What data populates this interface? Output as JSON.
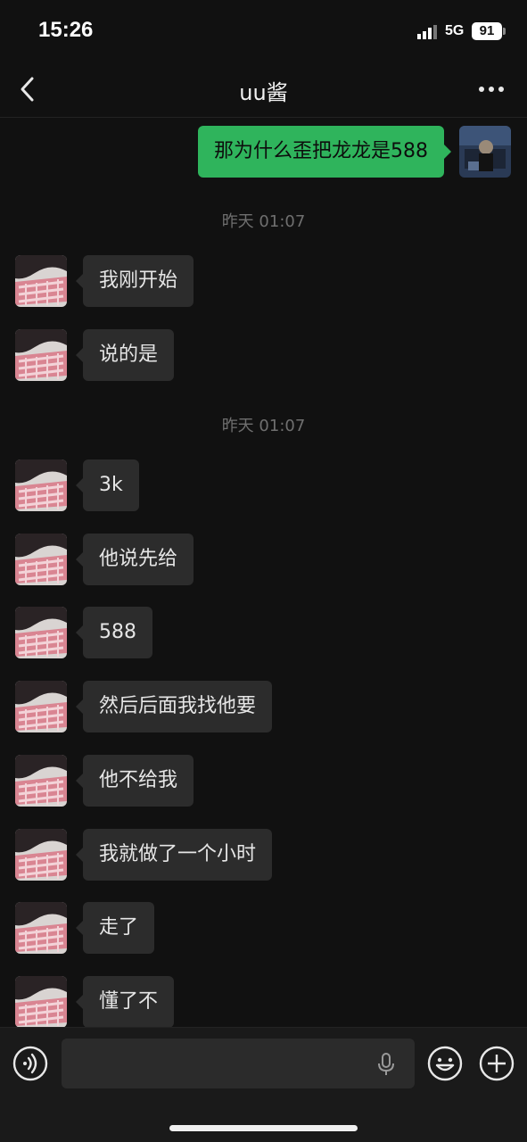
{
  "status_bar": {
    "time": "15:26",
    "network": "5G",
    "battery": "91"
  },
  "nav": {
    "title": "uu酱"
  },
  "messages": [
    {
      "type": "out",
      "text": "那为什么歪把龙龙是588"
    },
    {
      "type": "time",
      "text": "昨天 01:07"
    },
    {
      "type": "in",
      "text": "我刚开始"
    },
    {
      "type": "in",
      "text": "说的是"
    },
    {
      "type": "time",
      "text": "昨天 01:07"
    },
    {
      "type": "in",
      "text": "3k"
    },
    {
      "type": "in",
      "text": "他说先给"
    },
    {
      "type": "in",
      "text": "588"
    },
    {
      "type": "in",
      "text": "然后后面我找他要"
    },
    {
      "type": "in",
      "text": "他不给我"
    },
    {
      "type": "in",
      "text": "我就做了一个小时"
    },
    {
      "type": "in",
      "text": "走了"
    },
    {
      "type": "in",
      "text": "懂了不"
    }
  ],
  "input": {
    "value": ""
  },
  "colors": {
    "background": "#111111",
    "bubble_in": "#2c2c2c",
    "bubble_out": "#2fb45c",
    "timestamp": "#6f6f6f"
  },
  "icons": {
    "back": "chevron-left-icon",
    "more": "more-dots-icon",
    "voice": "voice-icon",
    "mic": "mic-icon",
    "emoji": "emoji-icon",
    "add": "plus-icon"
  }
}
